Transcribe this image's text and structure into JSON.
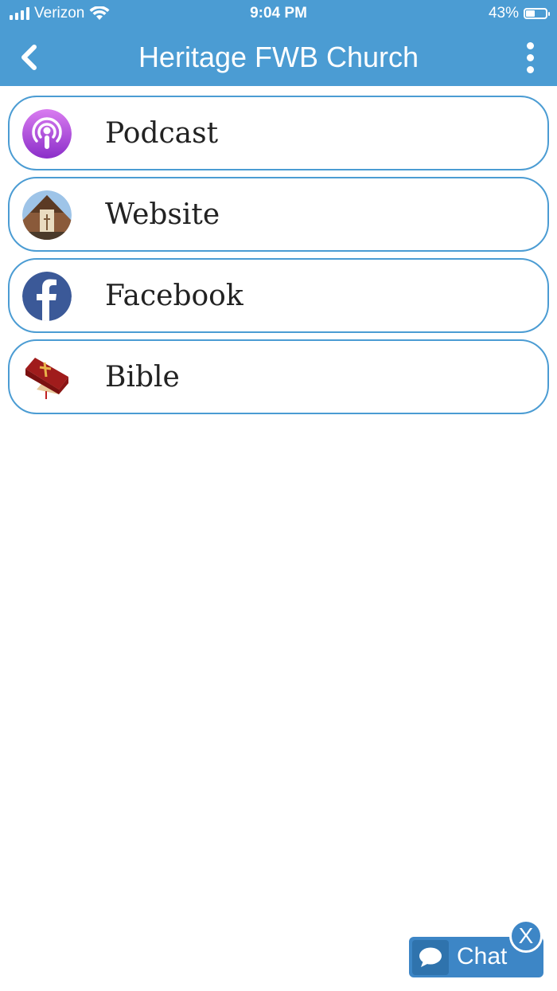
{
  "status_bar": {
    "carrier": "Verizon",
    "time": "9:04 PM",
    "battery": "43%"
  },
  "header": {
    "title": "Heritage FWB Church",
    "back_icon": "chevron-left-icon",
    "menu_icon": "more-vertical-icon"
  },
  "items": [
    {
      "label": "Podcast",
      "icon": "podcast-icon"
    },
    {
      "label": "Website",
      "icon": "church-photo-icon"
    },
    {
      "label": "Facebook",
      "icon": "facebook-icon"
    },
    {
      "label": "Bible",
      "icon": "bible-icon"
    }
  ],
  "chat": {
    "label": "Chat",
    "close_label": "X"
  },
  "colors": {
    "header": "#4b9cd3",
    "item_border": "#4b9cd3",
    "chat_button": "#3d86c6",
    "podcast": "#b04bd8",
    "facebook": "#3b5998",
    "bible": "#a01c1c"
  }
}
